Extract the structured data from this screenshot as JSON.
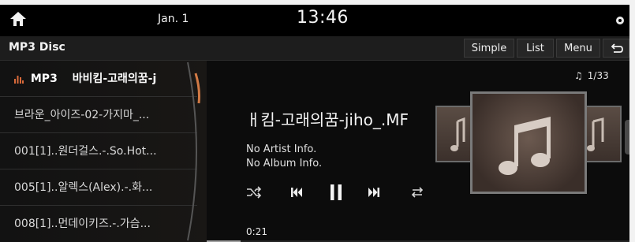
{
  "status": {
    "date": "Jan. 1",
    "time": "13:46"
  },
  "header": {
    "title": "MP3 Disc",
    "buttons": {
      "simple": "Simple",
      "list": "List",
      "menu": "Menu"
    }
  },
  "playlist": {
    "items": [
      {
        "tag": "MP3",
        "label": "바비킴-고래의꿈-j"
      },
      {
        "label": "브라운_아이즈-02-가지마_..."
      },
      {
        "label": "001[1]..원더걸스.-.So.Hot..."
      },
      {
        "label": "005[1]..알렉스(Alex).-.화..."
      },
      {
        "label": "008[1]..먼데이키즈.-.가슴..."
      }
    ]
  },
  "now_playing": {
    "track_counter": "1/33",
    "title": "ㅐ킴-고래의꿈-jiho_.MF",
    "artist": "No Artist Info.",
    "album": "No Album Info.",
    "elapsed": "0:21",
    "progress_fraction": 0.08
  }
}
